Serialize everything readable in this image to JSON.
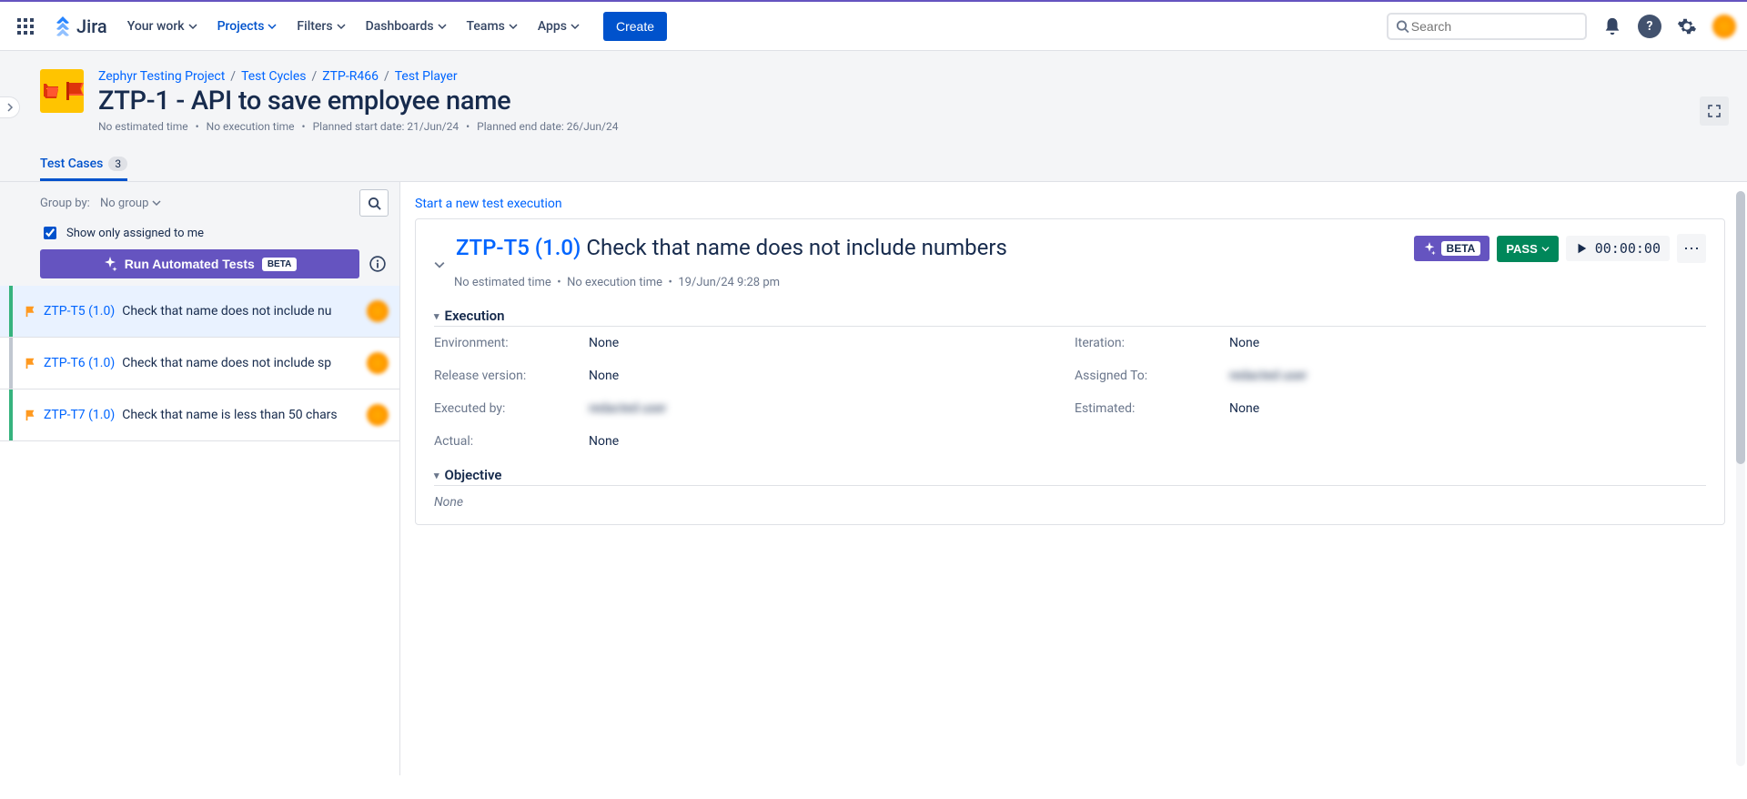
{
  "nav": {
    "logo": "Jira",
    "items": [
      {
        "label": "Your work"
      },
      {
        "label": "Projects",
        "active": true
      },
      {
        "label": "Filters"
      },
      {
        "label": "Dashboards"
      },
      {
        "label": "Teams"
      },
      {
        "label": "Apps"
      }
    ],
    "create": "Create",
    "search_placeholder": "Search"
  },
  "breadcrumbs": [
    "Zephyr Testing Project",
    "Test Cycles",
    "ZTP-R466",
    "Test Player"
  ],
  "page_title": "ZTP-1 - API to save employee name",
  "page_meta": {
    "no_est": "No estimated time",
    "no_exec": "No execution time",
    "planned_start": "Planned start date: 21/Jun/24",
    "planned_end": "Planned end date: 26/Jun/24"
  },
  "tab": {
    "label": "Test Cases",
    "count": "3"
  },
  "left": {
    "group_by_label": "Group by:",
    "group_by_value": "No group",
    "show_assigned": "Show only assigned to me",
    "run_btn": "Run Automated Tests",
    "run_beta": "BETA",
    "items": [
      {
        "bar": "green",
        "key": "ZTP-T5 (1.0)",
        "name": "Check that name does not include nu",
        "selected": true
      },
      {
        "bar": "gray",
        "key": "ZTP-T6 (1.0)",
        "name": "Check that name does not include sp",
        "selected": false
      },
      {
        "bar": "green",
        "key": "ZTP-T7 (1.0)",
        "name": "Check that name is less than 50 chars",
        "selected": false
      }
    ]
  },
  "right": {
    "start_link": "Start a new test execution",
    "title_key": "ZTP-T5 (1.0)",
    "title_name": "Check that name does not include numbers",
    "meta": {
      "no_est": "No estimated time",
      "no_exec": "No execution time",
      "date": "19/Jun/24 9:28 pm"
    },
    "beta_label": "BETA",
    "status": "PASS",
    "timer": "00:00:00",
    "execution_heading": "Execution",
    "fields": {
      "environment_k": "Environment:",
      "environment_v": "None",
      "iteration_k": "Iteration:",
      "iteration_v": "None",
      "release_k": "Release version:",
      "release_v": "None",
      "assigned_k": "Assigned To:",
      "assigned_v": "redacted user",
      "executed_k": "Executed by:",
      "executed_v": "redacted user",
      "estimated_k": "Estimated:",
      "estimated_v": "None",
      "actual_k": "Actual:",
      "actual_v": "None"
    },
    "objective_heading": "Objective",
    "objective_value": "None"
  }
}
